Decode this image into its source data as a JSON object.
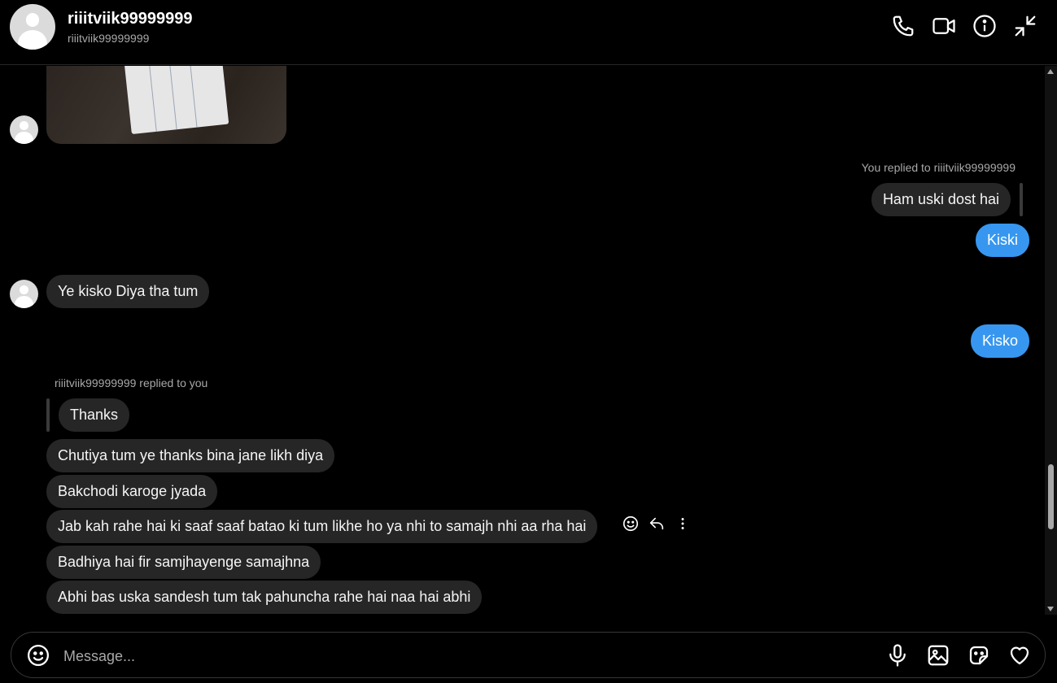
{
  "header": {
    "display_name": "riiitviik99999999",
    "username": "riiitviik99999999",
    "icons": [
      "phone-icon",
      "video-icon",
      "info-icon",
      "minimize-icon"
    ]
  },
  "messages": {
    "reply_meta_out": "You replied to riiitviik99999999",
    "quoted_out": "Ham uski dost hai",
    "out_1": "Kiski",
    "in_1": "Ye kisko Diya tha tum",
    "out_2": "Kisko",
    "reply_meta_in": "riiitviik99999999 replied to you",
    "quoted_in": "Thanks",
    "in_2": "Chutiya tum ye thanks bina jane likh diya",
    "in_3": "Bakchodi karoge jyada",
    "in_4": "Jab kah rahe hai ki saaf saaf batao ki tum likhe ho ya nhi to samajh nhi aa rha hai",
    "in_5": "Badhiya hai fir samjhayenge samajhna",
    "in_6": "Abhi bas uska sandesh tum tak pahuncha rahe hai naa hai abhi"
  },
  "composer": {
    "placeholder": "Message..."
  },
  "colors": {
    "background": "#000000",
    "incoming_bubble": "#262626",
    "outgoing_bubble": "#3797f0"
  }
}
